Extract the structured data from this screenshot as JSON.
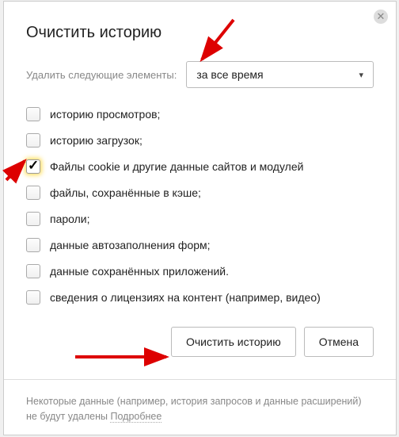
{
  "dialog": {
    "title": "Очистить историю",
    "select_label": "Удалить следующие элементы:",
    "select_value": "за все время",
    "checkboxes": [
      {
        "label": "историю просмотров;",
        "checked": false
      },
      {
        "label": "историю загрузок;",
        "checked": false
      },
      {
        "label": "Файлы cookie и другие данные сайтов и модулей",
        "checked": true
      },
      {
        "label": "файлы, сохранённые в кэше;",
        "checked": false
      },
      {
        "label": "пароли;",
        "checked": false
      },
      {
        "label": "данные автозаполнения форм;",
        "checked": false
      },
      {
        "label": "данные сохранённых приложений.",
        "checked": false
      },
      {
        "label": "сведения о лицензиях на контент (например, видео)",
        "checked": false
      }
    ],
    "buttons": {
      "confirm": "Очистить историю",
      "cancel": "Отмена"
    },
    "footer_text": "Некоторые данные (например, история запросов и данные расширений) не будут удалены ",
    "footer_link": "Подробнее"
  }
}
